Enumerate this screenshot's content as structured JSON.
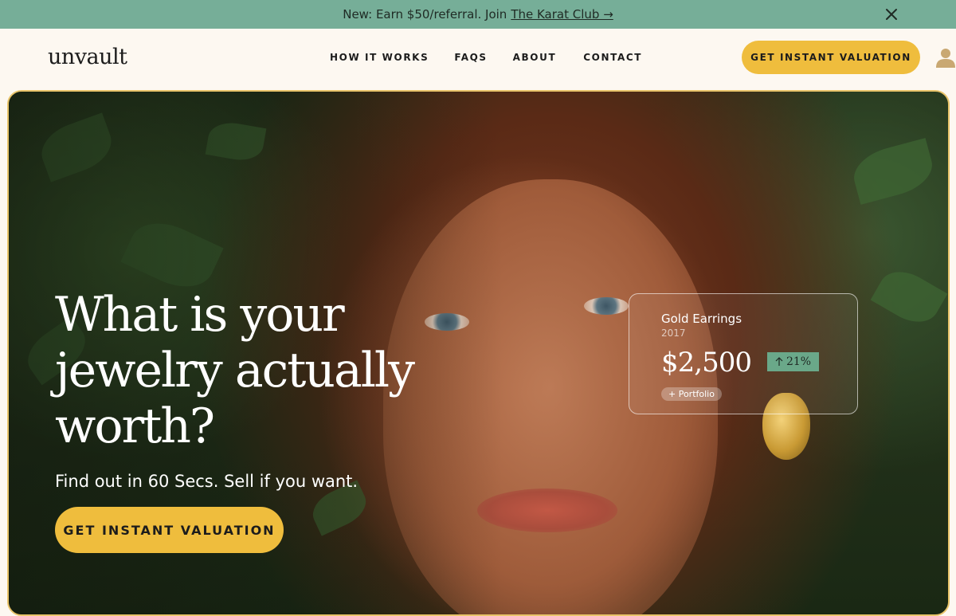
{
  "announcement": {
    "lead": "New: Earn $50/referral. Join",
    "link": "The Karat Club →"
  },
  "header": {
    "logo": "unvault",
    "nav": [
      "HOW IT WORKS",
      "FAQS",
      "ABOUT",
      "CONTACT"
    ],
    "cta": "GET INSTANT VALUATION"
  },
  "hero": {
    "title": "What is your jewelry actually worth?",
    "subtitle": "Find out in 60 Secs. Sell if you want.",
    "cta": "GET INSTANT VALUATION"
  },
  "card": {
    "item": "Gold Earrings",
    "year": "2017",
    "price": "$2,500",
    "change": "21%",
    "portfolio": "+ Portfolio"
  },
  "icons": {
    "close": "close-icon",
    "user": "user-icon",
    "arrow_up": "arrow-up-icon"
  },
  "colors": {
    "announcement_bg": "#76ae98",
    "page_bg": "#fdf8f1",
    "accent": "#efbd3d",
    "change_badge": "#6aa889"
  }
}
